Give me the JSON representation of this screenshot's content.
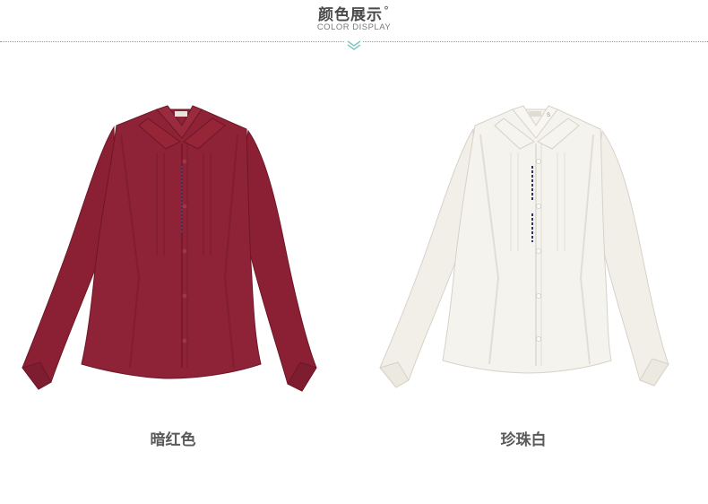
{
  "header": {
    "title": "颜色展示",
    "title_mark": "°",
    "subtitle": "COLOR DISPLAY",
    "accent_color": "#7ec6c0",
    "divider_icon": "double-chevron-down-icon"
  },
  "products": [
    {
      "name": "暗红色",
      "color": "#8e2236",
      "image": "burgundy-shirt"
    },
    {
      "name": "珍珠白",
      "color": "#f4f2ec",
      "image": "pearl-white-shirt"
    }
  ]
}
